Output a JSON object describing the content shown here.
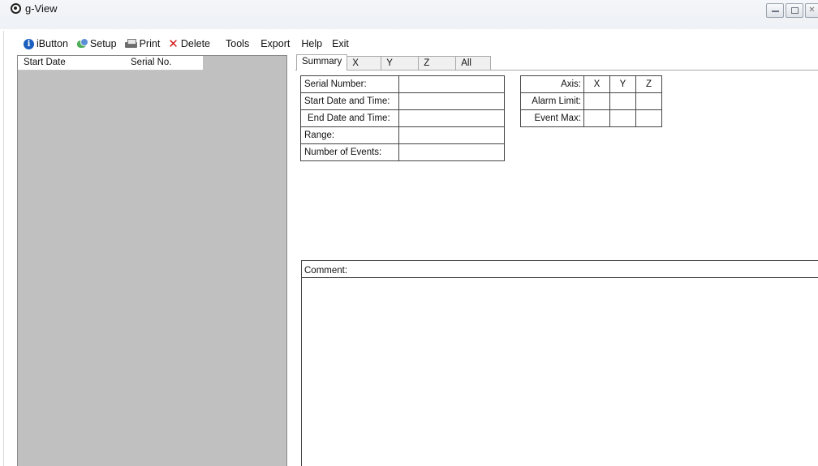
{
  "window": {
    "title": "g-View",
    "icon": "target-icon"
  },
  "menubar": {
    "items": [
      {
        "label": "iButton",
        "icon": "info-icon"
      },
      {
        "label": "Setup",
        "icon": "setup-icon"
      },
      {
        "label": "Print",
        "icon": "printer-icon"
      },
      {
        "label": "Delete",
        "icon": "delete-x-icon"
      },
      {
        "label": "Tools"
      },
      {
        "label": "Export"
      },
      {
        "label": "Help"
      },
      {
        "label": "Exit"
      }
    ]
  },
  "list": {
    "columns": [
      "Start Date",
      "Serial No."
    ]
  },
  "tabs": [
    "Summary",
    "X",
    "Y",
    "Z",
    "All"
  ],
  "summary": {
    "rows": [
      {
        "label": "Serial Number:",
        "value": ""
      },
      {
        "label": "Start Date and Time:",
        "value": ""
      },
      {
        "label": "End Date and Time:",
        "value": ""
      },
      {
        "label": "Range:",
        "value": ""
      },
      {
        "label": "Number of Events:",
        "value": ""
      }
    ]
  },
  "axis_table": {
    "header_label": "Axis:",
    "axes": [
      "X",
      "Y",
      "Z"
    ],
    "rows": [
      {
        "label": "Alarm Limit:",
        "values": [
          "",
          "",
          ""
        ]
      },
      {
        "label": "Event Max:",
        "values": [
          "",
          "",
          ""
        ]
      }
    ]
  },
  "comment": {
    "label": "Comment:",
    "value": ""
  },
  "colors": {
    "panel_gray": "#c0c0c0",
    "delete_red": "#d11a1a",
    "info_blue": "#1b5fbf"
  }
}
